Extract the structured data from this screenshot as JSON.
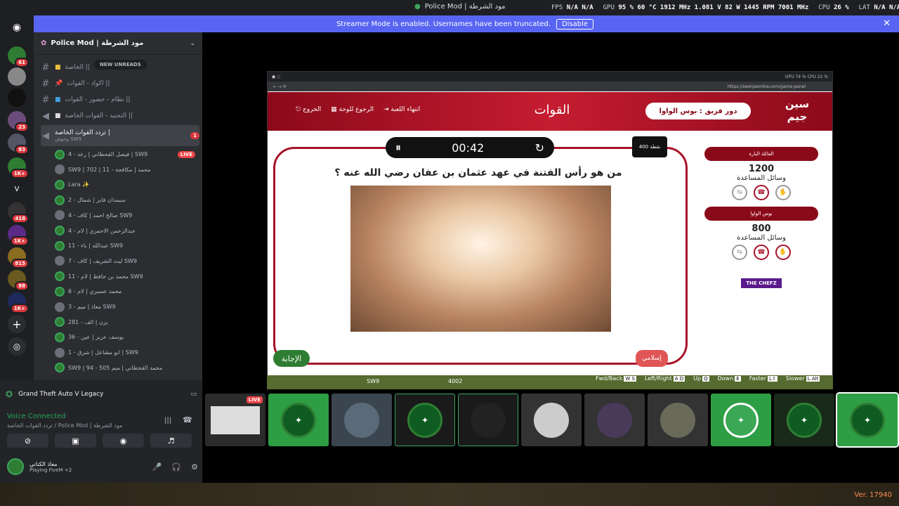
{
  "window": {
    "title": "Police Mod | مود الشرطة"
  },
  "overlay": {
    "fps_label": "FPS",
    "fps": "N/A N/A",
    "gpu_label": "GPU",
    "gpu": "95 % 60 °C 1912 MHz 1.081 V 82 W 1445 RPM 7001 MHz",
    "cpu_label": "CPU",
    "cpu": "26 %",
    "lat_label": "LAT",
    "lat": "N/A N/A"
  },
  "banner": {
    "text": "Streamer Mode is enabled. Usernames have been truncated.",
    "button": "Disable"
  },
  "servers": [
    {
      "badge": "61"
    },
    {
      "badge": ""
    },
    {
      "badge": ""
    },
    {
      "badge": "23"
    },
    {
      "badge": "83"
    },
    {
      "badge": "1K+"
    },
    {
      "label": "V",
      "badge": ""
    },
    {
      "badge": "418"
    },
    {
      "badge": "1K+"
    },
    {
      "badge": "815"
    },
    {
      "badge": "88"
    },
    {
      "badge": "1K+"
    }
  ],
  "guild": {
    "name": "Police Mod | مود الشرطة",
    "new_unreads": "NEW UNREADS"
  },
  "channels": [
    {
      "name": "الخاصة ||"
    },
    {
      "name": "اكواد - القوات ||"
    },
    {
      "name": "نظام - حضور - القوات ||"
    },
    {
      "name": "التجنيد - القوات الخاصة ||"
    },
    {
      "name": "تردد القوات الخاصة |",
      "mention": "1",
      "sub": "وحوش SW9"
    }
  ],
  "voice_users": [
    {
      "name": "فيصل القحطاني | رعد - 4 | SW9",
      "live": "LIVE"
    },
    {
      "name": "SW9 | محمد | مكافحة - 11 | 702"
    },
    {
      "name": "Lara ✨"
    },
    {
      "name": "سيمدان فايز | شمال - 2"
    },
    {
      "name": "صالح احمد | كاف - 4 SW9"
    },
    {
      "name": "عبدالرحمن الاحمري | لام - 4"
    },
    {
      "name": "عبدالله | باء - 11 SW9"
    },
    {
      "name": "ليث الشريف | كاف - 7 SW9"
    },
    {
      "name": "محمد بن حافظ | لام - 11 SW9"
    },
    {
      "name": "محمد عسيري | لام - 6"
    },
    {
      "name": "معاذ | ميم - 3 SW9"
    },
    {
      "name": "يزن | الف - 281"
    },
    {
      "name": "يوسف عزيز | عين - 36"
    },
    {
      "name": "ابو مشاعل | شرق - 1 | SW9"
    },
    {
      "name": "SW9 | 94 - محمد القحطاني | ميم 505"
    }
  ],
  "activity": {
    "game": "Grand Theft Auto V Legacy"
  },
  "voice": {
    "status": "Voice Connected",
    "channel": "تردد القوات الخاصة / Police Mod | مود الشرطة"
  },
  "user": {
    "name": "معاذ الكناني",
    "status": "Playing FiveM +2"
  },
  "game": {
    "browser_url": "https://seenjeemkw.com/game-panel",
    "logo": "سين جيم",
    "team_turn": "دور فريق : بوس الواوا",
    "section": "القوات",
    "end_game": "انتهاء اللعبة",
    "back_board": "الرجوع للوحة",
    "exit": "الخروج",
    "timer": "00:42",
    "points": "400 نقطة",
    "question": "من هو رأس الفتنة في عهد عثمان بن عفان رضي الله عنه ؟",
    "answer_button": "الإجابة",
    "category": "إسلامي",
    "teams": [
      {
        "name": "العائلة البارة",
        "score": "1200",
        "aids": "وسائل المساعدة"
      },
      {
        "name": "بوس الواوا",
        "score": "800",
        "aids": "وسائل المساعدة"
      }
    ],
    "sponsor": "THE CHEFZ",
    "strip_text": "SW9",
    "strip_num": "4002"
  },
  "keyhints": [
    {
      "label": "Fwd/Back",
      "keys": "W S"
    },
    {
      "label": "Left/Right",
      "keys": "A D"
    },
    {
      "label": "Up",
      "keys": "Q"
    },
    {
      "label": "Down",
      "keys": "E"
    },
    {
      "label": "Faster",
      "keys": "L⇧"
    },
    {
      "label": "Slower",
      "keys": "L Alt"
    }
  ],
  "tiles": {
    "live": "LIVE"
  },
  "version": "Ver. 17940"
}
